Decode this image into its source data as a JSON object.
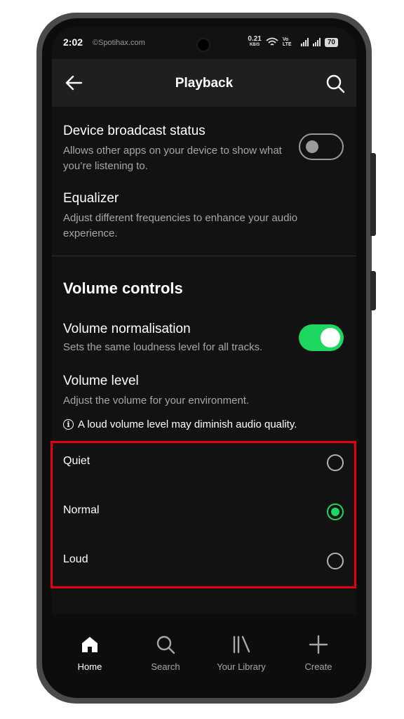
{
  "status_bar": {
    "time": "2:02",
    "watermark": "©Spotihax.com",
    "net_speed": "0.21",
    "net_unit": "KB/S",
    "volte": "Vo LTE",
    "battery": "70"
  },
  "header": {
    "title": "Playback",
    "back_icon": "arrow-left-icon",
    "search_icon": "search-icon"
  },
  "settings": {
    "broadcast": {
      "title": "Device broadcast status",
      "description": "Allows other apps on your device to show what you’re listening to.",
      "enabled": false
    },
    "equalizer": {
      "title": "Equalizer",
      "description": "Adjust different frequencies to enhance your audio experience."
    }
  },
  "volume_controls": {
    "section_title": "Volume controls",
    "normalisation": {
      "title": "Volume normalisation",
      "description": "Sets the same loudness level for all tracks.",
      "enabled": true
    },
    "level": {
      "title": "Volume level",
      "description": "Adjust the volume for your environment.",
      "warning": "A loud volume level may diminish audio quality.",
      "options": [
        {
          "label": "Quiet",
          "selected": false
        },
        {
          "label": "Normal",
          "selected": true
        },
        {
          "label": "Loud",
          "selected": false
        }
      ]
    }
  },
  "bottom_nav": {
    "items": [
      {
        "label": "Home",
        "icon": "home-icon",
        "active": true
      },
      {
        "label": "Search",
        "icon": "search-icon",
        "active": false
      },
      {
        "label": "Your Library",
        "icon": "library-icon",
        "active": false
      },
      {
        "label": "Create",
        "icon": "plus-icon",
        "active": false
      }
    ]
  },
  "colors": {
    "accent": "#1ed760",
    "background": "#121212",
    "highlight": "#e3000f"
  }
}
